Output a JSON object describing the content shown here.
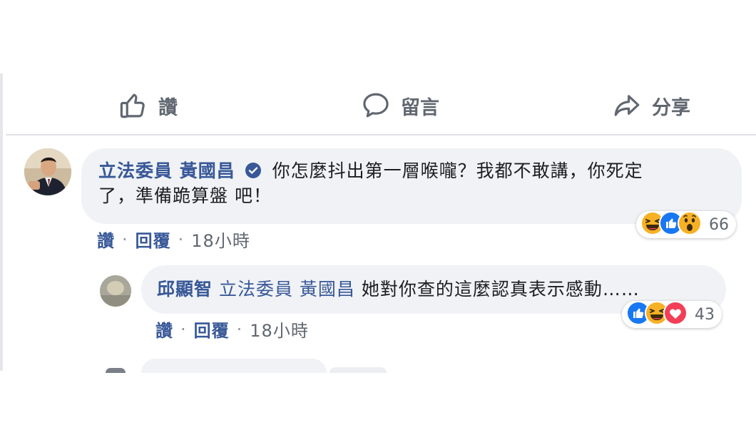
{
  "actions": {
    "like_label": "讚",
    "comment_label": "留言",
    "share_label": "分享"
  },
  "comments": [
    {
      "author": "立法委員 黃國昌",
      "verified": true,
      "text_line1": "你怎麼抖出第一層喉嚨？我都不敢講，你死定",
      "text_line2": "了，準備跪算盤 吧！",
      "like_label": "讚",
      "reply_label": "回覆",
      "time": "18小時",
      "reactions": [
        "haha",
        "like",
        "wow"
      ],
      "reaction_count": "66"
    },
    {
      "author": "邱顯智",
      "mention": "立法委員 黃國昌",
      "text": "她對你查的這麼認真表示感動……",
      "like_label": "讚",
      "reply_label": "回覆",
      "time": "18小時",
      "reactions": [
        "like",
        "haha",
        "love"
      ],
      "reaction_count": "43"
    }
  ],
  "colors": {
    "link": "#385898",
    "meta": "#606770",
    "bubble": "#f0f2f5",
    "like_blue": "#1877f2",
    "love_red": "#f33e58",
    "emoji_yellow": "#f7b125"
  }
}
